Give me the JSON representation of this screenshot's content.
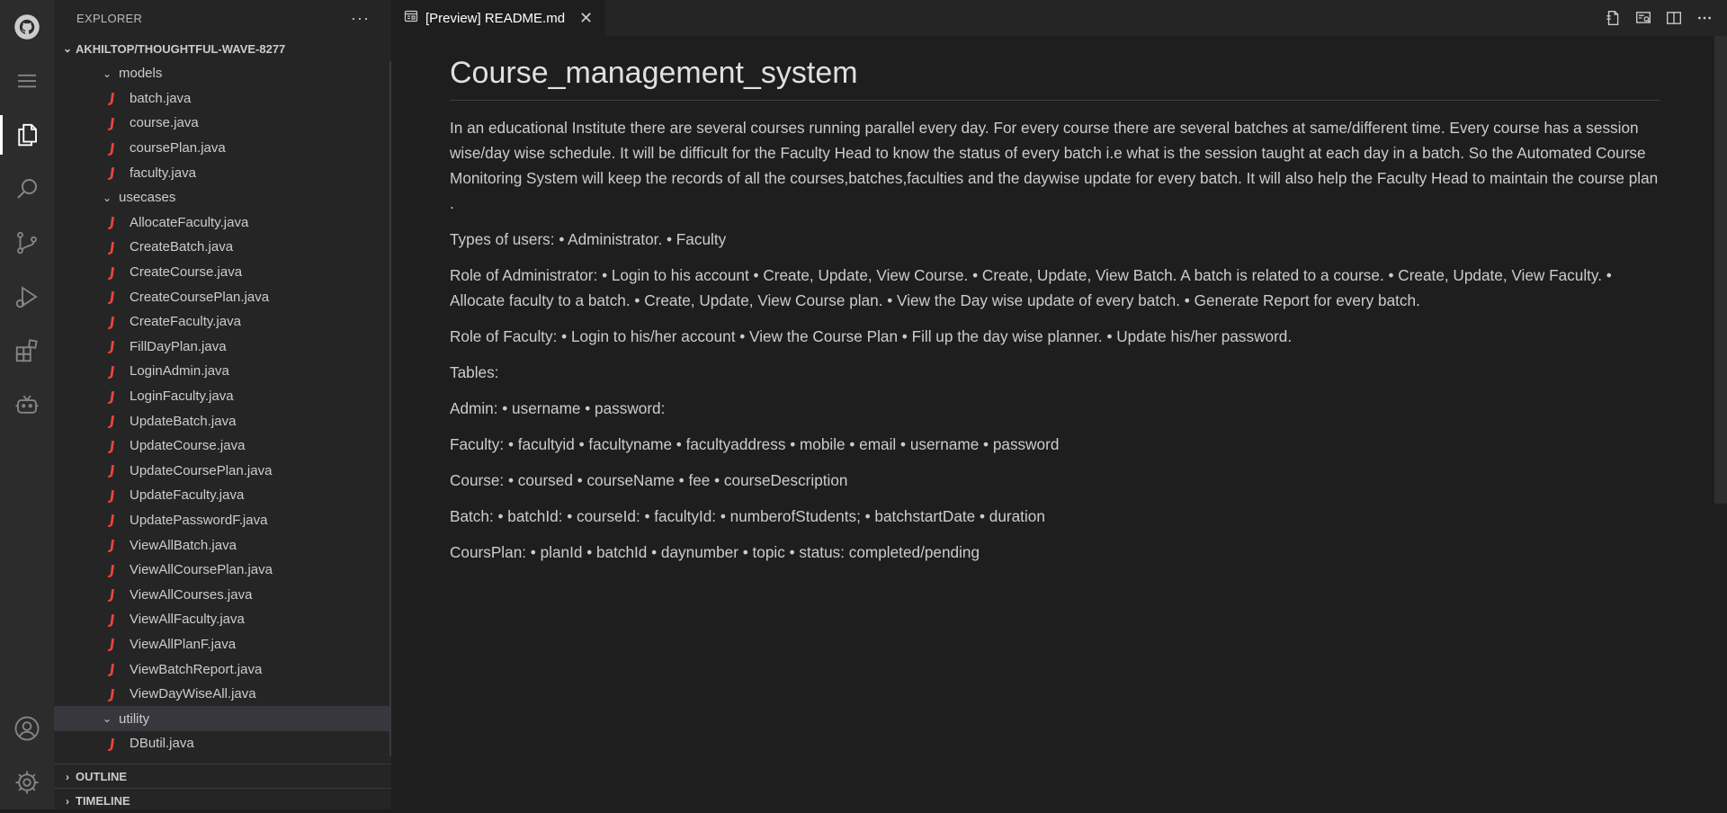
{
  "activity_bar": {
    "items": [
      {
        "name": "github-icon"
      },
      {
        "name": "menu-icon"
      },
      {
        "name": "explorer-icon"
      },
      {
        "name": "search-icon"
      },
      {
        "name": "source-control-icon"
      },
      {
        "name": "run-debug-icon"
      },
      {
        "name": "extensions-icon"
      },
      {
        "name": "copilot-icon"
      },
      {
        "name": "account-icon"
      },
      {
        "name": "settings-gear-icon"
      }
    ]
  },
  "sidebar": {
    "title": "EXPLORER",
    "more": "···",
    "root": "AKHILTOP/THOUGHTFUL-WAVE-8277",
    "folders": {
      "models": "models",
      "usecases": "usecases",
      "utility": "utility"
    },
    "models_files": [
      "batch.java",
      "course.java",
      "coursePlan.java",
      "faculty.java"
    ],
    "usecases_files": [
      "AllocateFaculty.java",
      "CreateBatch.java",
      "CreateCourse.java",
      "CreateCoursePlan.java",
      "CreateFaculty.java",
      "FillDayPlan.java",
      "LoginAdmin.java",
      "LoginFaculty.java",
      "UpdateBatch.java",
      "UpdateCourse.java",
      "UpdateCoursePlan.java",
      "UpdateFaculty.java",
      "UpdatePasswordF.java",
      "ViewAllBatch.java",
      "ViewAllCoursePlan.java",
      "ViewAllCourses.java",
      "ViewAllFaculty.java",
      "ViewAllPlanF.java",
      "ViewBatchReport.java",
      "ViewDayWiseAll.java"
    ],
    "utility_files": [
      "DButil.java"
    ],
    "file_icon_glyph": "J",
    "outline": "OUTLINE",
    "timeline": "TIMELINE"
  },
  "editor": {
    "tab_label": "[Preview] README.md",
    "tab_close": "✕",
    "title": "Course_management_system",
    "paragraphs": [
      "In an educational Institute there are several courses running parallel every day. For every course there are several batches at same/different time. Every course has a session wise/day wise schedule. It will be difficult for the Faculty Head to know the status of every batch i.e what is the session taught at each day in a batch. So the Automated Course Monitoring System will keep the records of all the courses,batches,faculties and the daywise update for every batch. It will also help the Faculty Head to maintain the course plan .",
      "Types of users: • Administrator. • Faculty",
      "Role of Administrator: • Login to his account • Create, Update, View Course. • Create, Update, View Batch. A batch is related to a course. • Create, Update, View Faculty. • Allocate faculty to a batch. • Create, Update, View Course plan. • View the Day wise update of every batch. • Generate Report for every batch.",
      "Role of Faculty: • Login to his/her account • View the Course Plan • Fill up the day wise planner. • Update his/her password.",
      "Tables:",
      "Admin: • username • password:",
      "Faculty: • facultyid • facultyname • facultyaddress • mobile • email • username • password",
      "Course: • coursed • courseName • fee • courseDescription",
      "Batch: • batchId: • courseId: • facultyId: • numberofStudents; • batchstartDate • duration",
      "CoursPlan: • planId • batchId • daynumber • topic • status: completed/pending"
    ]
  },
  "colors": {
    "java_icon": "#e8453c",
    "background": "#1e1e1e",
    "sidebar": "#252526",
    "activity_bar": "#2c2c2c"
  }
}
